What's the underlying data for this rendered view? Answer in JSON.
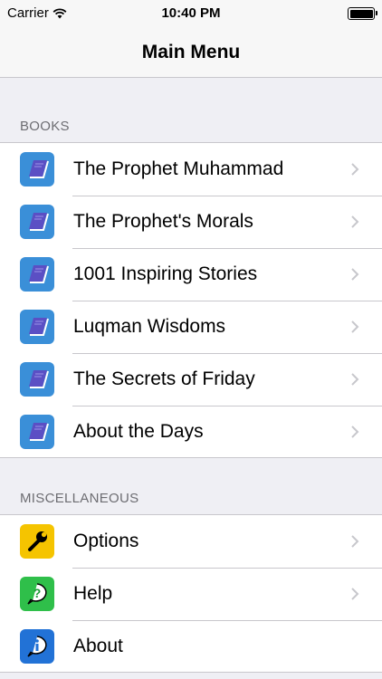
{
  "status_bar": {
    "carrier": "Carrier",
    "time": "10:40 PM"
  },
  "nav": {
    "title": "Main Menu"
  },
  "sections": {
    "books": {
      "header": "BOOKS",
      "items": [
        {
          "label": "The Prophet Muhammad",
          "icon": "book-icon"
        },
        {
          "label": "The Prophet's Morals",
          "icon": "book-icon"
        },
        {
          "label": "1001 Inspiring Stories",
          "icon": "book-icon"
        },
        {
          "label": "Luqman Wisdoms",
          "icon": "book-icon"
        },
        {
          "label": "The Secrets of Friday",
          "icon": "book-icon"
        },
        {
          "label": "About the Days",
          "icon": "book-icon"
        }
      ]
    },
    "misc": {
      "header": "MISCELLANEOUS",
      "items": [
        {
          "label": "Options",
          "icon": "wrench-icon"
        },
        {
          "label": "Help",
          "icon": "question-icon"
        },
        {
          "label": "About",
          "icon": "info-icon"
        }
      ]
    }
  },
  "colors": {
    "book_icon_bg": "#3a8fd8",
    "options_icon_bg": "#f5c400",
    "help_icon_bg": "#2fbf4a",
    "about_icon_bg": "#2272d6",
    "background": "#efeff4"
  }
}
